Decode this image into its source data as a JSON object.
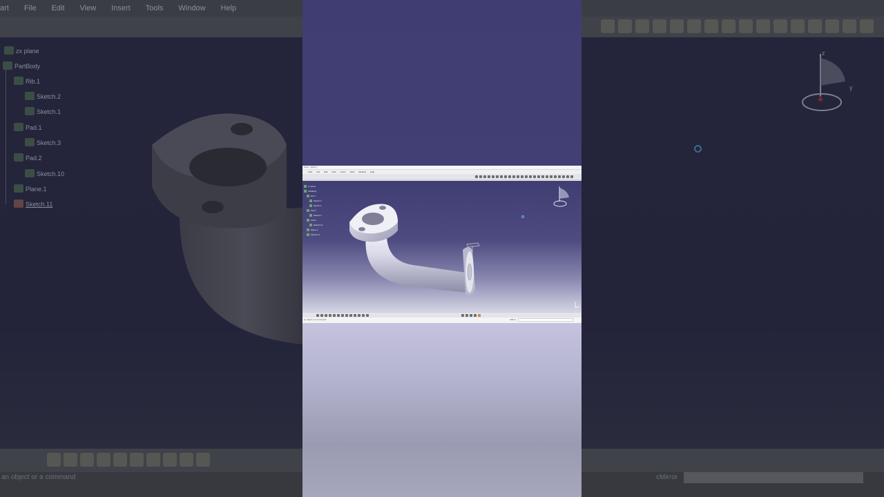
{
  "background": {
    "menu": [
      "art",
      "File",
      "Edit",
      "View",
      "Insert",
      "Tools",
      "Window",
      "Help"
    ],
    "tree": {
      "zx_plane": "zx plane",
      "part_body": "PartBody",
      "rib": "Rib.1",
      "sketch2": "Sketch.2",
      "sketch1": "Sketch.1",
      "pad1": "Pad.1",
      "sketch3": "Sketch.3",
      "pad2": "Pad.2",
      "sketch10": "Sketch.10",
      "plane1": "Plane.1",
      "sketch11": "Sketch.11"
    },
    "status_text": "an object or a command",
    "command_label": "cMirror",
    "compass": {
      "z": "z",
      "y": "y"
    }
  },
  "mini": {
    "title": "Part1 - [Part1]",
    "menu": [
      "Start",
      "File",
      "Edit",
      "View",
      "Insert",
      "Tools",
      "Window",
      "Help"
    ],
    "tree": [
      "zx plane",
      "PartBody",
      "Rib.1",
      "Sketch.2",
      "Sketch.1",
      "Pad.1",
      "Sketch.3",
      "Pad.2",
      "Sketch.10",
      "Plane.1",
      "Sketch.11"
    ],
    "status_text": "an object or a command",
    "command_label": "cMirror"
  },
  "colors": {
    "viewport_top": "#3f3d72",
    "viewport_bottom": "#d4d4e4",
    "accent_blue": "#6fb6e8"
  }
}
